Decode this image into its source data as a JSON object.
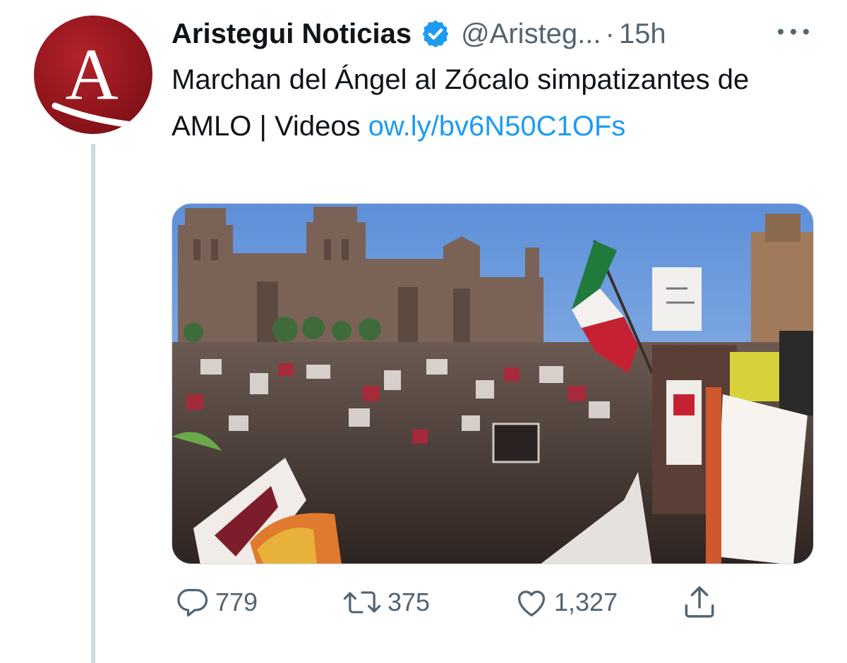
{
  "author": {
    "name": "Aristegui Noticias",
    "handle": "@Aristeg...",
    "separator": "·",
    "time": "15h",
    "avatar_letter": "A",
    "verified": true
  },
  "tweet": {
    "text": "Marchan del Ángel al Zócalo simpatizantes de AMLO | Videos ",
    "link": "ow.ly/bv6N50C1OFs"
  },
  "icons": {
    "verified": "verified-badge-icon",
    "more": "more-icon",
    "reply": "reply-icon",
    "retweet": "retweet-icon",
    "like": "like-icon",
    "share": "share-icon"
  },
  "actions": {
    "replies": "779",
    "retweets": "375",
    "likes": "1,327"
  },
  "colors": {
    "accent": "#1d9bf0",
    "brand_red": "#9b1b22",
    "muted": "#536471"
  }
}
